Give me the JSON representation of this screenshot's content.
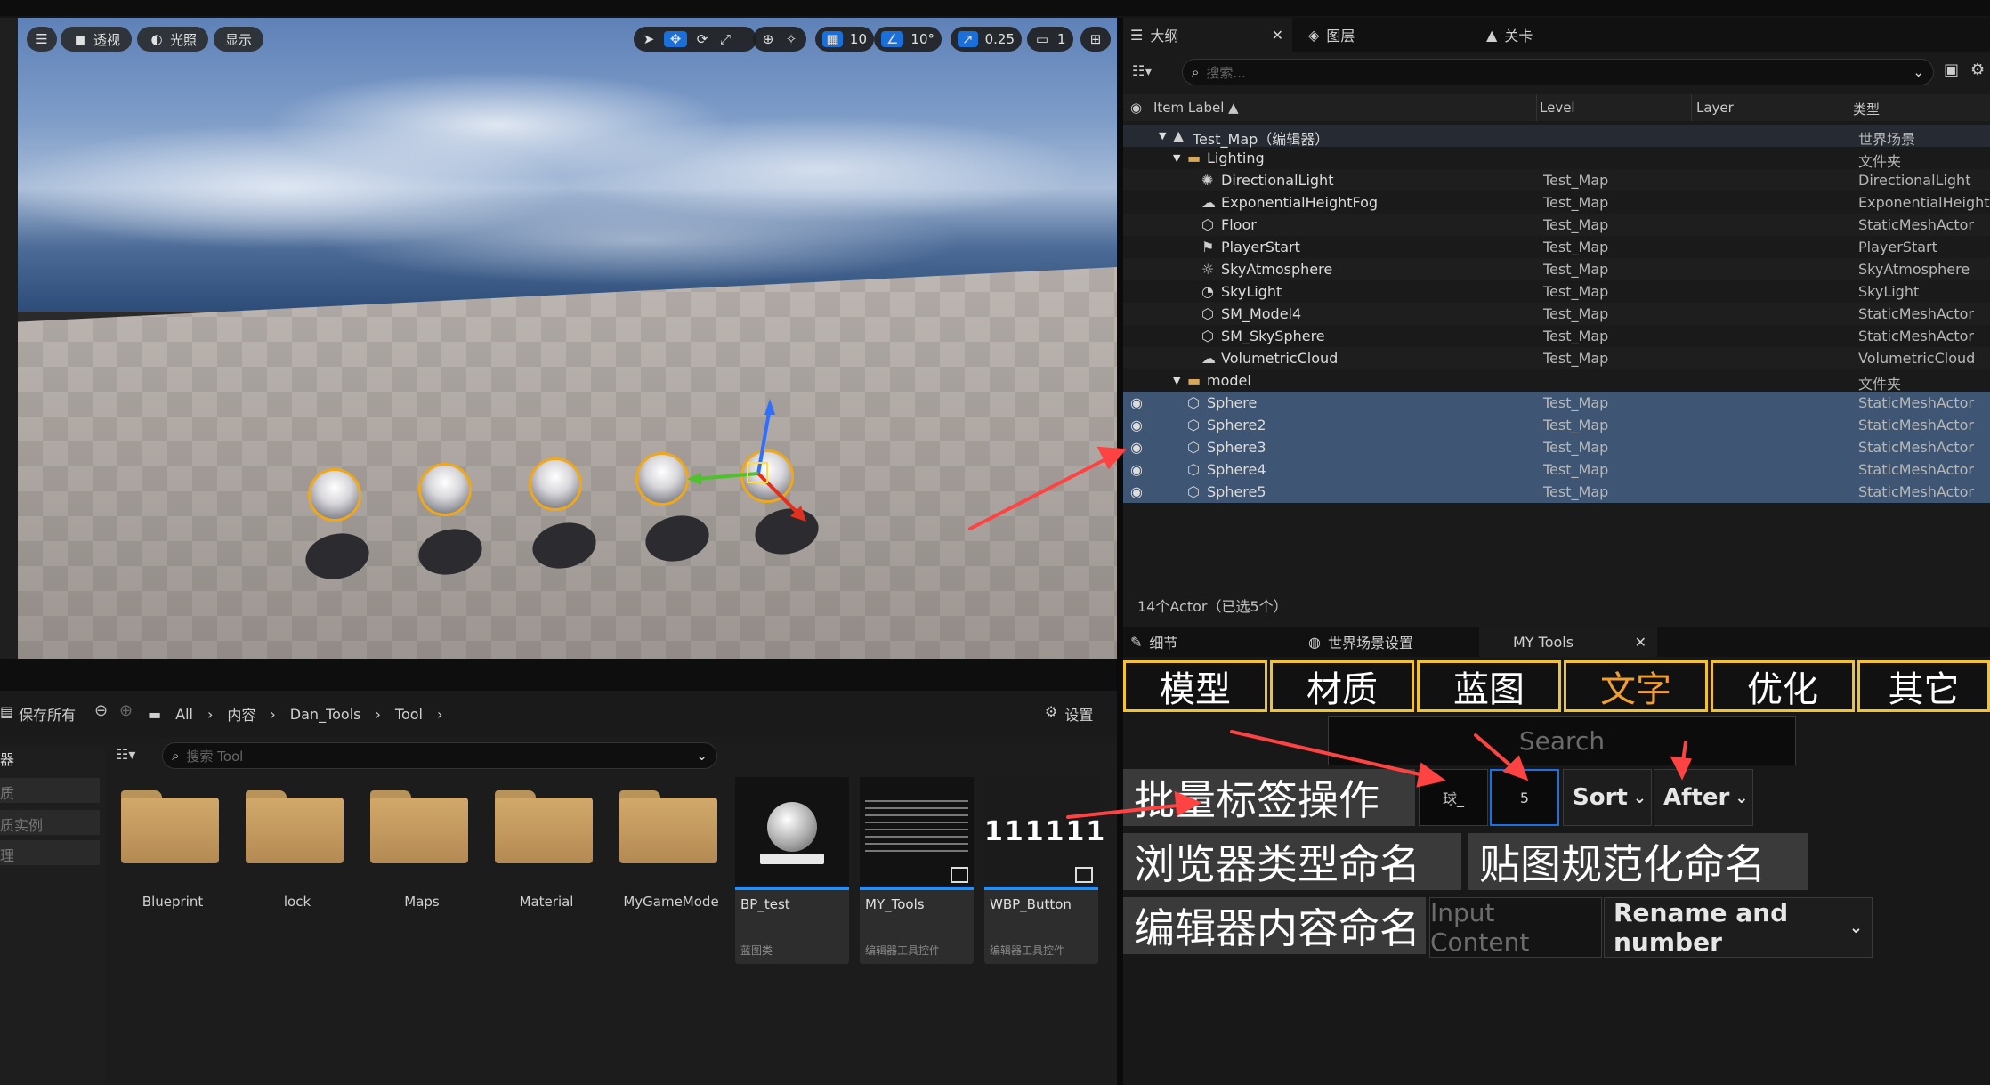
{
  "viewport": {
    "menu_icon": "hamburger-icon",
    "perspective_label": "透视",
    "lighting_label": "光照",
    "show_label": "显示",
    "grid_snap": "10",
    "rotate_snap": "10°",
    "scale_snap": "0.25",
    "camera_speed": "1"
  },
  "outliner": {
    "tabs": [
      {
        "label": "大纲",
        "icon": "list-icon"
      },
      {
        "label": "图层",
        "icon": "layers-icon"
      },
      {
        "label": "关卡",
        "icon": "level-icon"
      }
    ],
    "search_placeholder": "搜索...",
    "columns": {
      "label": "Item Label ▲",
      "level": "Level",
      "layer": "Layer",
      "type": "类型"
    },
    "rows": [
      {
        "label": "Test_Map（编辑器）",
        "level": "",
        "type": "世界场景",
        "indent": 0,
        "style": "head",
        "icon": "map-icon"
      },
      {
        "label": "Lighting",
        "level": "",
        "type": "文件夹",
        "indent": 1,
        "style": "",
        "icon": "folder-icon"
      },
      {
        "label": "DirectionalLight",
        "level": "Test_Map",
        "type": "DirectionalLight",
        "indent": 2,
        "style": "alt",
        "icon": "sun-icon"
      },
      {
        "label": "ExponentialHeightFog",
        "level": "Test_Map",
        "type": "ExponentialHeightFog",
        "indent": 2,
        "style": "",
        "icon": "fog-icon"
      },
      {
        "label": "Floor",
        "level": "Test_Map",
        "type": "StaticMeshActor",
        "indent": 2,
        "style": "alt",
        "icon": "mesh-icon"
      },
      {
        "label": "PlayerStart",
        "level": "Test_Map",
        "type": "PlayerStart",
        "indent": 2,
        "style": "",
        "icon": "flag-icon"
      },
      {
        "label": "SkyAtmosphere",
        "level": "Test_Map",
        "type": "SkyAtmosphere",
        "indent": 2,
        "style": "alt",
        "icon": "atmosphere-icon"
      },
      {
        "label": "SkyLight",
        "level": "Test_Map",
        "type": "SkyLight",
        "indent": 2,
        "style": "",
        "icon": "skylight-icon"
      },
      {
        "label": "SM_Model4",
        "level": "Test_Map",
        "type": "StaticMeshActor",
        "indent": 2,
        "style": "alt",
        "icon": "mesh-icon"
      },
      {
        "label": "SM_SkySphere",
        "level": "Test_Map",
        "type": "StaticMeshActor",
        "indent": 2,
        "style": "",
        "icon": "mesh-icon"
      },
      {
        "label": "VolumetricCloud",
        "level": "Test_Map",
        "type": "VolumetricCloud",
        "indent": 2,
        "style": "alt",
        "icon": "cloud-icon"
      },
      {
        "label": "model",
        "level": "",
        "type": "文件夹",
        "indent": 1,
        "style": "",
        "icon": "folder-icon"
      },
      {
        "label": "Sphere",
        "level": "Test_Map",
        "type": "StaticMeshActor",
        "indent": 1,
        "style": "sel",
        "icon": "mesh-icon"
      },
      {
        "label": "Sphere2",
        "level": "Test_Map",
        "type": "StaticMeshActor",
        "indent": 1,
        "style": "sel",
        "icon": "mesh-icon"
      },
      {
        "label": "Sphere3",
        "level": "Test_Map",
        "type": "StaticMeshActor",
        "indent": 1,
        "style": "sel",
        "icon": "mesh-icon"
      },
      {
        "label": "Sphere4",
        "level": "Test_Map",
        "type": "StaticMeshActor",
        "indent": 1,
        "style": "sel",
        "icon": "mesh-icon"
      },
      {
        "label": "Sphere5",
        "level": "Test_Map",
        "type": "StaticMeshActor",
        "indent": 1,
        "style": "sel",
        "icon": "mesh-icon"
      }
    ],
    "actor_count": "14个Actor（已选5个）"
  },
  "details": {
    "tabs": [
      {
        "label": "细节",
        "icon": "pencil-icon"
      },
      {
        "label": "世界场景设置",
        "icon": "globe-icon"
      },
      {
        "label": "MY Tools",
        "icon": ""
      }
    ]
  },
  "my_tools": {
    "categories": [
      "模型",
      "材质",
      "蓝图",
      "文字",
      "优化",
      "其它"
    ],
    "search_placeholder": "Search",
    "batch_label": "批量标签操作",
    "prefix_value": "球_",
    "number_value": "5",
    "sort_label": "Sort",
    "after_label": "After",
    "browser_type_naming": "浏览器类型命名",
    "texture_naming": "贴图规范化命名",
    "editor_content_naming": "编辑器内容命名",
    "input_placeholder": "Input Content",
    "rename_label": "Rename and number",
    "active_category_color": "#f0a030",
    "border_color": "#f1c232"
  },
  "content_browser": {
    "save_all": "保存所有",
    "breadcrumb": [
      "All",
      "内容",
      "Dan_Tools",
      "Tool"
    ],
    "settings": "设置",
    "search_placeholder": "搜索 Tool",
    "sidebar": [
      "器",
      "质",
      "质实例",
      "理"
    ],
    "folders": [
      "Blueprint",
      "lock",
      "Maps",
      "Material",
      "MyGameMode"
    ],
    "assets": [
      {
        "name": "BP_test",
        "kind": "蓝图类"
      },
      {
        "name": "MY_Tools",
        "kind": "编辑器工具控件"
      },
      {
        "name": "WBP_Button",
        "kind": "编辑器工具控件",
        "thumb_text": "111111"
      }
    ]
  }
}
